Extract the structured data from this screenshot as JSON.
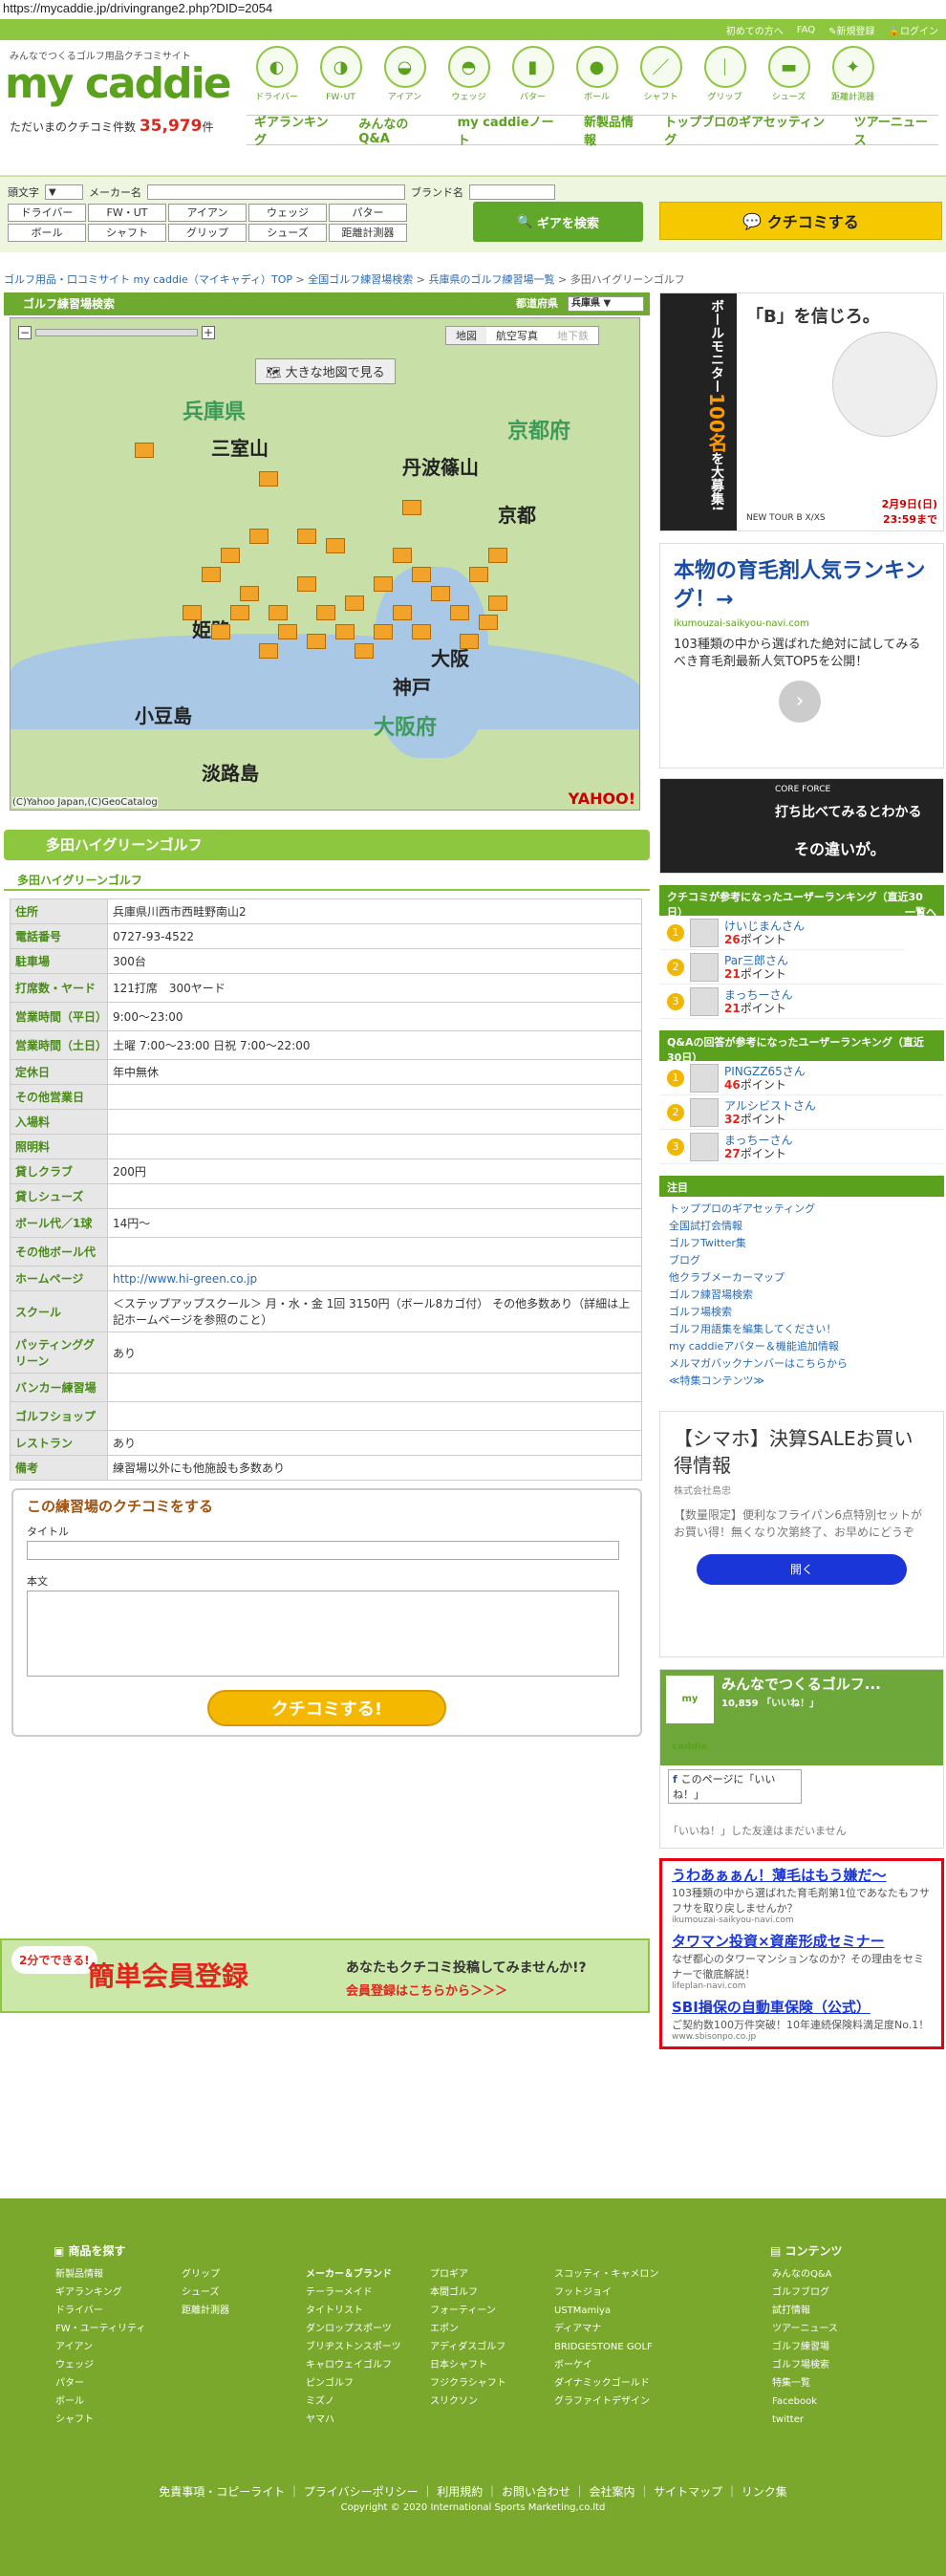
{
  "url": "https://mycaddie.jp/drivingrange2.php?DID=2054",
  "topbar": [
    "初めての方へ",
    "FAQ",
    "新規登録",
    "ログイン"
  ],
  "logo": {
    "tag": "みんなでつくるゴルフ用品クチコミサイト",
    "brand": "my caddie",
    "count_label": "ただいまのクチコミ件数",
    "count": "35,979",
    "unit": "件"
  },
  "cats": [
    "ドライバー",
    "FW･UT",
    "アイアン",
    "ウェッジ",
    "パター",
    "ボール",
    "シャフト",
    "グリップ",
    "シューズ",
    "距離計測器"
  ],
  "nav2": [
    "ギアランキング",
    "みんなのQ&A",
    "my caddieノート",
    "新製品情報",
    "トップブロのギアセッティング",
    "ツアーニュース"
  ],
  "search": {
    "l1": "頭文字",
    "l2": "メーカー名",
    "l3": "ブランド名",
    "cats": [
      "ドライバー",
      "FW・UT",
      "アイアン",
      "ウェッジ",
      "パター",
      "ボール",
      "シャフト",
      "グリップ",
      "シューズ",
      "距離計測器"
    ],
    "btn": "ギアを検索",
    "kuchikomi": "クチコミする"
  },
  "breadcrumb": [
    "ゴルフ用品・口コミサイト my caddie（マイキャディ）TOP",
    "全国ゴルフ練習場検索",
    "兵庫県のゴルフ練習場一覧",
    "多田ハイグリーンゴルフ"
  ],
  "map": {
    "title": "ゴルフ練習場検索",
    "pref_label": "都道府県",
    "pref": "兵庫県",
    "tab1": "地図",
    "tab2": "航空写真",
    "tab3": "地下鉄",
    "big": "大きな地図で見る",
    "copyright": "(C)Yahoo Japan,(C)GeoCatalog",
    "logo": "YAHOO!"
  },
  "place": {
    "name": "多田ハイグリーンゴルフ"
  },
  "rows": [
    [
      "住所",
      "兵庫県川西市西畦野南山2"
    ],
    [
      "電話番号",
      "0727-93-4522"
    ],
    [
      "駐車場",
      "300台"
    ],
    [
      "打席数・ヤード",
      "121打席　300ヤード"
    ],
    [
      "営業時間（平日）",
      "9:00～23:00"
    ],
    [
      "営業時間（土日）",
      "土曜 7:00～23:00 日祝 7:00～22:00"
    ],
    [
      "定休日",
      "年中無休"
    ],
    [
      "その他営業日",
      ""
    ],
    [
      "入場料",
      ""
    ],
    [
      "照明料",
      ""
    ],
    [
      "貸しクラブ",
      "200円"
    ],
    [
      "貸しシューズ",
      ""
    ],
    [
      "ボール代／1球",
      "14円～"
    ],
    [
      "その他ボール代",
      ""
    ],
    [
      "ホームページ",
      "http://www.hi-green.co.jp"
    ],
    [
      "スクール",
      "＜ステップアップスクール＞ 月・水・金 1回 3150円（ボール8カゴ付） その他多数あり（詳細は上記ホームページを参照のこと）"
    ],
    [
      "パッティンググリーン",
      "あり"
    ],
    [
      "バンカー練習場",
      ""
    ],
    [
      "ゴルフショップ",
      ""
    ],
    [
      "レストラン",
      "あり"
    ],
    [
      "備考",
      "練習場以外にも他施設も多数あり"
    ]
  ],
  "review": {
    "title": "この練習場のクチコミをする",
    "t": "タイトル",
    "b": "本文",
    "btn": "クチコミする!"
  },
  "reg": {
    "a": "2分でできる!",
    "b": "簡単会員登録",
    "c": "あなたもクチコミ投稿してみませんか!?",
    "d": "会員登録はこちらから＞＞＞"
  },
  "right": {
    "ad1": {
      "a": "ボールモニター",
      "b": "100名",
      "c": "を大募集!",
      "d": "「B」を信じろ。",
      "e": "2月9日(日)",
      "f": "23:59まで",
      "g": "NEW TOUR B X/XS"
    },
    "ad2": {
      "title": "本物の育毛剤人気ランキング！→",
      "domain": "ikumouzai-saikyou-navi.com",
      "body": "103種類の中から選ばれた絶対に試してみるべき育毛剤最新人気TOP5を公開！"
    },
    "ad3": {
      "a": "CORE FORCE",
      "b": "打ち比べてみるとわかる",
      "c": "その違いが。"
    },
    "rank1": {
      "title": "クチコミが参考になったユーザーランキング（直近30日）",
      "more": "一覧へ",
      "items": [
        [
          "けいじまんさん",
          "26"
        ],
        [
          "Par三郎さん",
          "21"
        ],
        [
          "まっちーさん",
          "21"
        ]
      ]
    },
    "rank2": {
      "title": "Q&Aの回答が参考になったユーザーランキング（直近30日）",
      "items": [
        [
          "PINGZZ65さん",
          "46"
        ],
        [
          "アルシビストさん",
          "32"
        ],
        [
          "まっちーさん",
          "27"
        ]
      ]
    },
    "pt": "ポイント",
    "notice": {
      "title": "注目",
      "items": [
        "トッププロのギアセッティング",
        "全国試打会情報",
        "ゴルフTwitter集",
        "ブログ",
        "他クラブメーカーマップ",
        "ゴルフ練習場検索",
        "ゴルフ場検索",
        "ゴルフ用語集を編集してください！",
        "my caddieアバター＆機能追加情報",
        "メルマガバックナンバーはこちらから",
        "≪特集コンテンツ≫"
      ]
    },
    "ad4": {
      "title": "【シマホ】決算SALEお買い得情報",
      "co": "株式会社島忠",
      "body": "【数量限定】便利なフライパン6点特別セットがお買い得！無くなり次第終了、お早めにどうぞ",
      "btn": "開く"
    },
    "fb": {
      "title": "みんなでつくるゴルフ...",
      "likes": "10,859 「いいね！」",
      "like": "このページに「いいね！」",
      "msg": "「いいね！」した友達はまだいません"
    },
    "ad5": [
      {
        "t": "うわあぁぁん！薄毛はもう嫌だ～",
        "b": "103種類の中から選ばれた育毛剤第1位であなたもフサフサを取り戻しませんか？",
        "d": "ikumouzai-saikyou-navi.com"
      },
      {
        "t": "タワマン投資×資産形成セミナー",
        "b": "なぜ都心のタワーマンションなのか？その理由をセミナーで徹底解説！",
        "d": "lifeplan-navi.com"
      },
      {
        "t": "SBI損保の自動車保険（公式）",
        "b": "ご契約数100万件突破！10年連続保険料満足度No.1！",
        "d": "www.sbisonpo.co.jp"
      }
    ]
  },
  "footer": {
    "h1": "商品を探す",
    "h2": "コンテンツ",
    "c1": [
      "新製品情報",
      "ギアランキング",
      "ドライバー",
      "FW・ユーティリティ",
      "アイアン",
      "ウェッジ",
      "パター",
      "ボール",
      "シャフト"
    ],
    "c2": [
      "グリップ",
      "シューズ",
      "距離計測器"
    ],
    "c3": [
      "メーカー＆ブランド",
      "テーラーメイド",
      "タイトリスト",
      "ダンロップスポーツ",
      "ブリヂストンスポーツ",
      "キャロウェイゴルフ",
      "ピンゴルフ",
      "ミズノ",
      "ヤマハ"
    ],
    "c4": [
      "",
      "プロギア",
      "本間ゴルフ",
      "フォーティーン",
      "エポン",
      "アディダスゴルフ",
      "日本シャフト",
      "フジクラシャフト",
      "スリクソン"
    ],
    "c5": [
      "",
      "スコッティ・キャメロン",
      "フットジョイ",
      "USTMamiya",
      "ディアマナ",
      "BRIDGESTONE GOLF",
      "ボーケイ",
      "ダイナミックゴールド",
      "グラファイトデザイン"
    ],
    "c6": [
      "みんなのQ&A",
      "ゴルフブログ",
      "試打情報",
      "ツアーニュース",
      "ゴルフ練習場",
      "ゴルフ場検索",
      "特集一覧",
      "Facebook",
      "twitter"
    ],
    "links": "免責事項・コピーライト ｜ プライバシーポリシー ｜ 利用規約 ｜ お問い合わせ ｜ 会社案内 ｜ サイトマップ ｜ リンク集",
    "copy": "Copyright © 2020 International Sports Marketing,co.ltd"
  }
}
